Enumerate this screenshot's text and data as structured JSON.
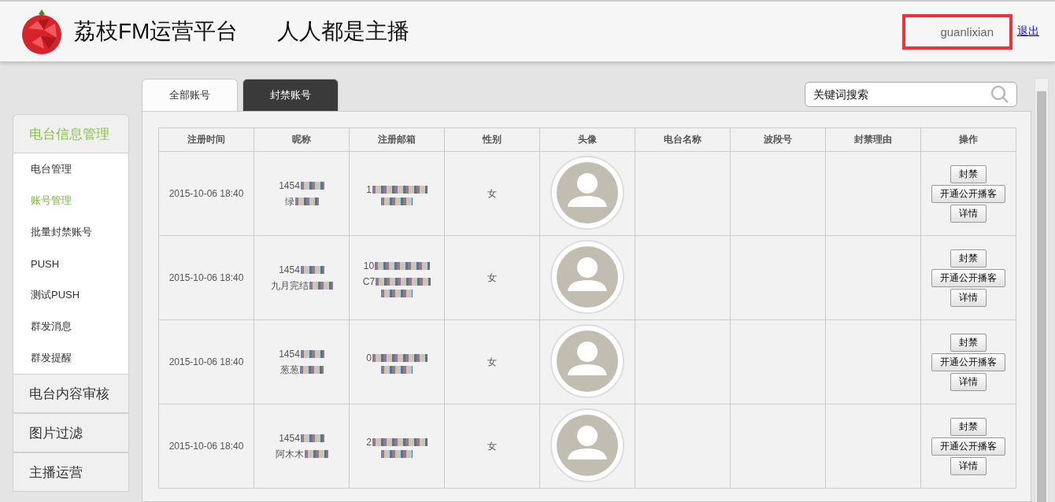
{
  "header": {
    "title": "荔枝FM运营平台",
    "slogan": "人人都是主播",
    "username": "guanlixian",
    "logout": "退出"
  },
  "sidebar": {
    "sections": [
      {
        "label": "电台信息管理",
        "expanded": true,
        "items": [
          {
            "label": "电台管理",
            "selected": false
          },
          {
            "label": "账号管理",
            "selected": true
          },
          {
            "label": "批量封禁账号",
            "selected": false
          },
          {
            "label": "PUSH",
            "selected": false
          },
          {
            "label": "测试PUSH",
            "selected": false
          },
          {
            "label": "群发消息",
            "selected": false
          },
          {
            "label": "群发提醒",
            "selected": false
          }
        ]
      },
      {
        "label": "电台内容审核",
        "expanded": false
      },
      {
        "label": "图片过滤",
        "expanded": false
      },
      {
        "label": "主播运营",
        "expanded": false
      }
    ]
  },
  "tabs": [
    {
      "label": "全部账号",
      "selected": true
    },
    {
      "label": "封禁账号",
      "selected": false
    }
  ],
  "search": {
    "placeholder": "关键词搜索"
  },
  "table": {
    "columns": [
      "注册时间",
      "昵称",
      "注册邮箱",
      "性别",
      "头像",
      "电台名称",
      "波段号",
      "封禁理由",
      "操作"
    ],
    "rows": [
      {
        "time": "2015-10-06 18:40",
        "nickname": [
          {
            "text": "1454",
            "redacted": true
          },
          {
            "text": "绿",
            "redacted": true
          }
        ],
        "email": [
          {
            "text": "1",
            "redacted": true
          },
          {
            "redacted": true
          }
        ],
        "gender": "女",
        "actions": [
          "封禁",
          "开通公开播客",
          "详情"
        ]
      },
      {
        "time": "2015-10-06 18:40",
        "nickname": [
          {
            "text": "1454",
            "redacted": true
          },
          {
            "text": "九月完结",
            "redacted": true
          }
        ],
        "email": [
          {
            "text": "10",
            "redacted": true
          },
          {
            "text": "C7",
            "redacted": true
          },
          {
            "redacted": true
          }
        ],
        "gender": "女",
        "actions": [
          "封禁",
          "开通公开播客",
          "详情"
        ]
      },
      {
        "time": "2015-10-06 18:40",
        "nickname": [
          {
            "text": "1454",
            "redacted": true
          },
          {
            "text": "葱葱",
            "redacted": true
          }
        ],
        "email": [
          {
            "text": "0",
            "redacted": true
          },
          {
            "redacted": true
          }
        ],
        "gender": "女",
        "actions": [
          "封禁",
          "开通公开播客",
          "详情"
        ]
      },
      {
        "time": "2015-10-06 18:40",
        "nickname": [
          {
            "text": "1454",
            "redacted": true
          },
          {
            "text": "阿木木",
            "redacted": true
          }
        ],
        "email": [
          {
            "text": "2",
            "redacted": true
          },
          {
            "redacted": true
          }
        ],
        "gender": "女",
        "actions": [
          "封禁",
          "开通公开播客",
          "详情"
        ]
      }
    ]
  }
}
